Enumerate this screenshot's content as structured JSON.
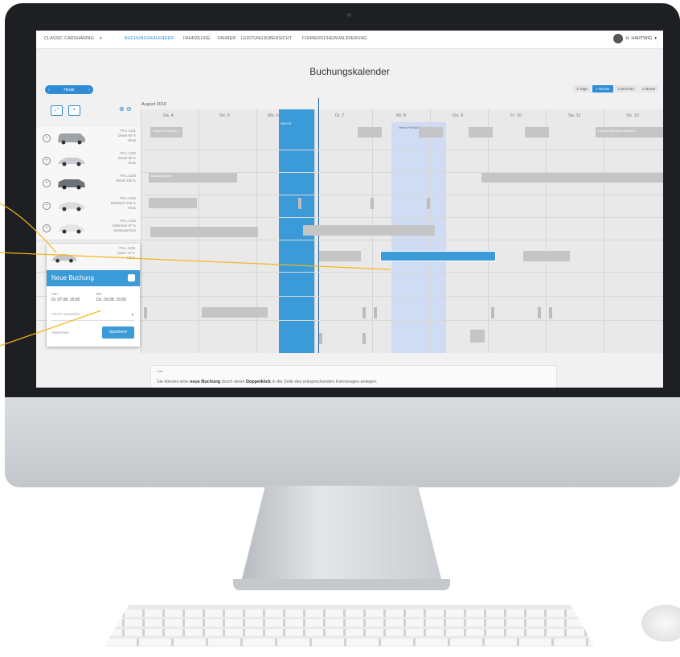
{
  "nav": {
    "brand": "CLASSIC CARSHARING",
    "items": [
      "BUCHUNGSKALENDER",
      "FAHRZEUGE",
      "FAHRER",
      "LEISTUNGSÜBERSICHT",
      "FÜHRERSCHEINVALIDIERUNG"
    ],
    "active": "BUCHUNGSKALENDER",
    "user": "H. HARTWIG"
  },
  "page": {
    "title": "Buchungskalender"
  },
  "toolbar": {
    "today_label": "Heute",
    "views": [
      "2 Tage",
      "1 Woche",
      "2 Wochen",
      "1 Monat"
    ],
    "active_view": "1 Woche"
  },
  "calendar": {
    "month": "August 2016",
    "days": [
      "Sa. 4",
      "So. 5",
      "Mo. 6",
      "Di. 7",
      "Mi. 8",
      "Do. 9",
      "Fr. 10",
      "Sa. 11",
      "So. 12"
    ],
    "today_tag": "HEUTE",
    "bookings": [
      "Horst Fuchs (Intl.)",
      "Barbara Maier",
      "Heinz Fröhlich Jugoslav",
      "Lennart Wilhelm Lehmann"
    ]
  },
  "vehicles": [
    {
      "plate": "FN-L 2101",
      "info": "Diesel 80 %",
      "loc": "Hbuk"
    },
    {
      "plate": "FN-L 2102",
      "info": "Diesel 60 %",
      "loc": "Hbuk"
    },
    {
      "plate": "FN-L 2103",
      "info": "Diesel 100 %",
      "loc": ""
    },
    {
      "plate": "FN-L 2104",
      "info": "Elektrisch 100 %",
      "loc": "Hbuk"
    },
    {
      "plate": "FN-L 2105",
      "info": "Elektrisch 67 %",
      "loc": "Seebauerrhein"
    }
  ],
  "popup": {
    "plate": "FN-L 2106",
    "info": "Super 72 %",
    "loc": "Hbuk",
    "title": "Neue Buchung",
    "from_label": "Von",
    "from_value": "Di. 07.08. 15:00",
    "to_label": "Bis",
    "to_value": "Do. 09.08. 15:00",
    "driver_placeholder": "Fahrer auswählen",
    "cancel": "Abbrechen",
    "save": "Speichern"
  },
  "hint": {
    "small": "Hilfe",
    "prefix": "Sie können eine ",
    "bold1": "neue Buchung",
    "middle": " durch einen ",
    "bold2": "Doppelklick",
    "suffix": " in die Zeile des entsprechenden Fahrzeuges anlegen."
  },
  "colors": {
    "accent": "#2e8bd6",
    "today": "#3a9bd8",
    "booking": "#c5c5c5",
    "callout": "#f3b61f"
  }
}
